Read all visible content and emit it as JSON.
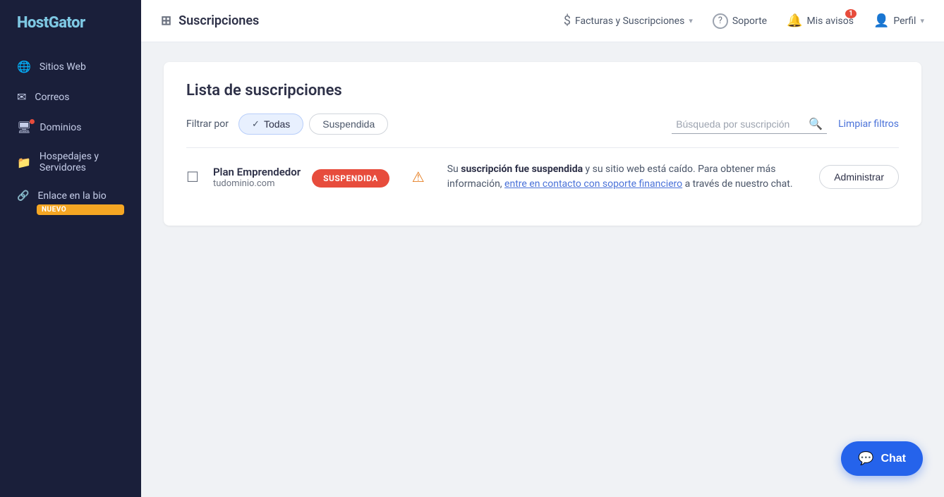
{
  "sidebar": {
    "logo": "HostGator",
    "items": [
      {
        "id": "sitios-web",
        "label": "Sitios Web",
        "icon": "🌐",
        "hasDot": false
      },
      {
        "id": "correos",
        "label": "Correos",
        "icon": "✉",
        "hasDot": false
      },
      {
        "id": "dominios",
        "label": "Dominios",
        "icon": "🖥",
        "hasDot": true
      },
      {
        "id": "hospedajes",
        "label": "Hospedajes y Servidores",
        "icon": "📁",
        "hasDot": false
      }
    ],
    "enlace_bio": {
      "label": "Enlace en la bio",
      "icon": "🔗",
      "badge": "NUEVO"
    }
  },
  "header": {
    "title": "Suscripciones",
    "title_icon": "☰",
    "nav": {
      "facturas": {
        "label": "Facturas y Suscripciones",
        "icon": "$"
      },
      "soporte": {
        "label": "Soporte",
        "icon": "?"
      },
      "mis_avisos": {
        "label": "Mis avisos",
        "notification_count": "1"
      },
      "perfil": {
        "label": "Perfil"
      }
    }
  },
  "page": {
    "title": "Lista de suscripciones",
    "filter_label": "Filtrar por",
    "filter_todas": "Todas",
    "filter_suspendida": "Suspendida",
    "search_placeholder": "Búsqueda por suscripción",
    "clear_filters": "Limpiar filtros",
    "subscription": {
      "name": "Plan Emprendedor",
      "domain": "tudominio.com",
      "status": "SUSPENDIDA",
      "message_part1": "Su ",
      "message_bold": "suscripción fue suspendida",
      "message_part2": " y su sitio web está caído. Para obtener más información, ",
      "message_link": "entre en contacto con soporte financiero",
      "message_part3": " a través de nuestro chat.",
      "admin_button": "Administrar"
    }
  },
  "chat": {
    "label": "Chat"
  }
}
